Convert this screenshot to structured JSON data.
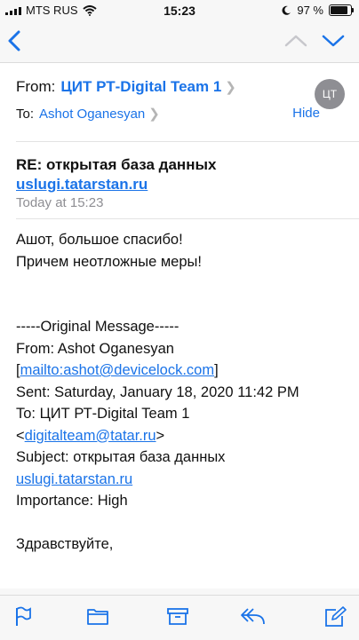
{
  "status": {
    "carrier": "MTS RUS",
    "time": "15:23",
    "battery_pct": "97 %",
    "battery_level": 0.97
  },
  "nav": {
    "back_icon": "chevron-left-icon",
    "up_icon": "chevron-up-icon",
    "down_icon": "chevron-down-icon"
  },
  "header": {
    "from_label": "From:",
    "from_name": "ЦИТ РТ-Digital Team 1",
    "to_label": "To:",
    "to_name": "Ashot Oganesyan",
    "hide": "Hide",
    "avatar": "ЦТ"
  },
  "message": {
    "subject": "RE: открытая база данных",
    "subject_link": "uslugi.tatarstan.ru",
    "date": "Today at 15:23"
  },
  "body": {
    "line1": "Ашот, большое спасибо!",
    "line2": "Причем неотложные меры!",
    "orig_header": "-----Original Message-----",
    "orig_from": "From: Ashot Oganesyan",
    "orig_mailto_open": "[",
    "orig_mailto": "mailto:ashot@devicelock.com",
    "orig_mailto_close": "]",
    "orig_sent": "Sent: Saturday, January 18, 2020 11:42 PM",
    "orig_to": "To: ЦИТ РТ-Digital Team 1",
    "orig_to_open": "<",
    "orig_to_email": "digitalteam@tatar.ru",
    "orig_to_close": ">",
    "orig_subject": "Subject: открытая база данных",
    "orig_subject_link": "uslugi.tatarstan.ru",
    "orig_importance": "Importance: High",
    "greeting": "Здравствуйте,"
  },
  "toolbar": {
    "items": [
      "flag-icon",
      "folder-icon",
      "archive-icon",
      "reply-icon",
      "compose-icon"
    ]
  },
  "colors": {
    "accent": "#1a73e8",
    "gray": "#8e8e93"
  }
}
